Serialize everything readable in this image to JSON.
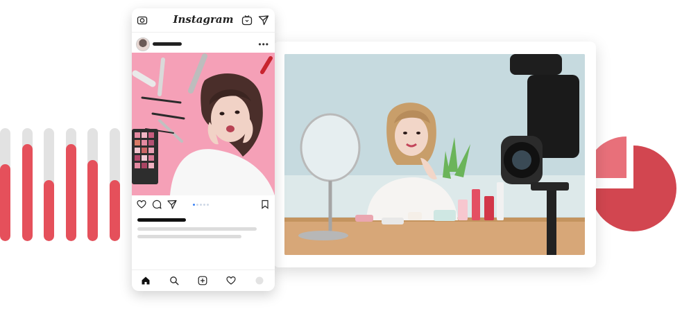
{
  "colors": {
    "accent": "#e5505b",
    "bar_track": "#e2e2e2",
    "ig_pink": "#f39ab3"
  },
  "bar_levels": [
    0.68,
    0.86,
    0.54,
    0.86,
    0.72,
    0.54
  ],
  "instagram": {
    "app_title": "Instagram",
    "icons": {
      "camera": "camera-icon",
      "igtv": "igtv-icon",
      "direct": "direct-message-icon",
      "more": "more-options-icon",
      "like": "heart-icon",
      "comment": "comment-icon",
      "share": "send-icon",
      "save": "bookmark-icon",
      "home": "home-icon",
      "search": "search-icon",
      "add": "add-post-icon",
      "activity": "activity-heart-icon",
      "profile": "profile-icon"
    },
    "more_glyph": "•••",
    "carousel": {
      "count": 5,
      "active": 1
    }
  },
  "video": {
    "scene": "beauty-vlogger-filming"
  }
}
